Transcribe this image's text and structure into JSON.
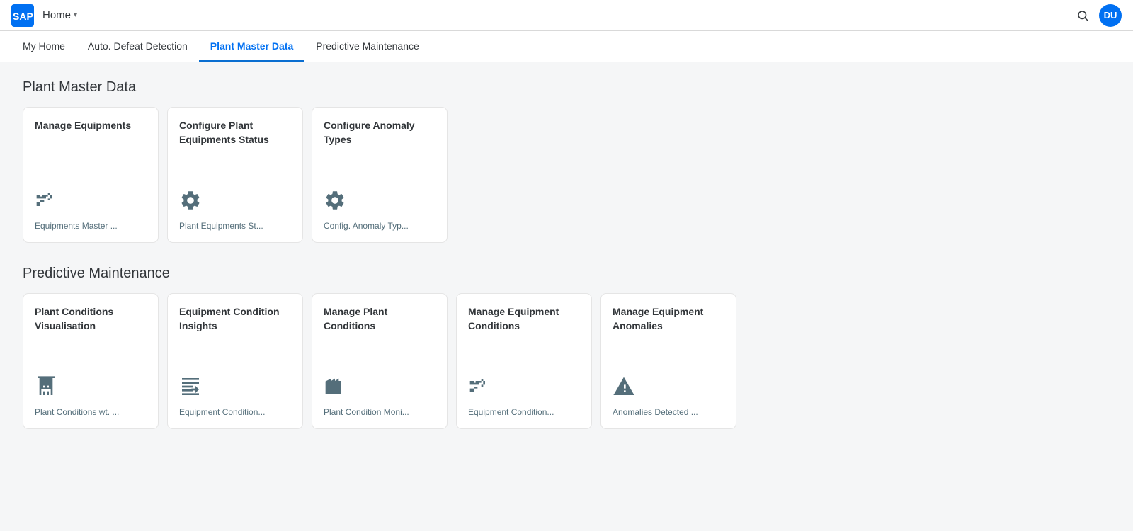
{
  "header": {
    "logo_label": "SAP",
    "home_label": "Home",
    "home_chevron": "▾",
    "search_icon": "search",
    "avatar_label": "DU"
  },
  "nav": {
    "tabs": [
      {
        "id": "my-home",
        "label": "My Home",
        "active": false
      },
      {
        "id": "auto-defeat",
        "label": "Auto. Defeat Detection",
        "active": false
      },
      {
        "id": "plant-master-data",
        "label": "Plant Master Data",
        "active": true
      },
      {
        "id": "predictive-maintenance",
        "label": "Predictive Maintenance",
        "active": false
      }
    ]
  },
  "sections": [
    {
      "id": "plant-master-data",
      "title": "Plant Master Data",
      "tiles": [
        {
          "id": "manage-equipments",
          "title": "Manage Equipments",
          "icon": "equipment",
          "subtitle": "Equipments Master ..."
        },
        {
          "id": "configure-plant-equipment-status",
          "title": "Configure Plant Equipments Status",
          "icon": "gear",
          "subtitle": "Plant Equipments St..."
        },
        {
          "id": "configure-anomaly-types",
          "title": "Configure Anomaly Types",
          "icon": "gear",
          "subtitle": "Config. Anomaly Typ..."
        }
      ]
    },
    {
      "id": "predictive-maintenance",
      "title": "Predictive Maintenance",
      "tiles": [
        {
          "id": "plant-conditions-visualisation",
          "title": "Plant Conditions Visualisation",
          "icon": "building",
          "subtitle": "Plant Conditions wt. ..."
        },
        {
          "id": "equipment-condition-insights",
          "title": "Equipment Condition Insights",
          "icon": "chart",
          "subtitle": "Equipment Condition..."
        },
        {
          "id": "manage-plant-conditions",
          "title": "Manage Plant Conditions",
          "icon": "factory",
          "subtitle": "Plant Condition Moni..."
        },
        {
          "id": "manage-equipment-conditions",
          "title": "Manage Equipment Conditions",
          "icon": "equipment",
          "subtitle": "Equipment Condition..."
        },
        {
          "id": "manage-equipment-anomalies",
          "title": "Manage Equipment Anomalies",
          "icon": "warning",
          "subtitle": "Anomalies Detected ..."
        }
      ]
    }
  ]
}
